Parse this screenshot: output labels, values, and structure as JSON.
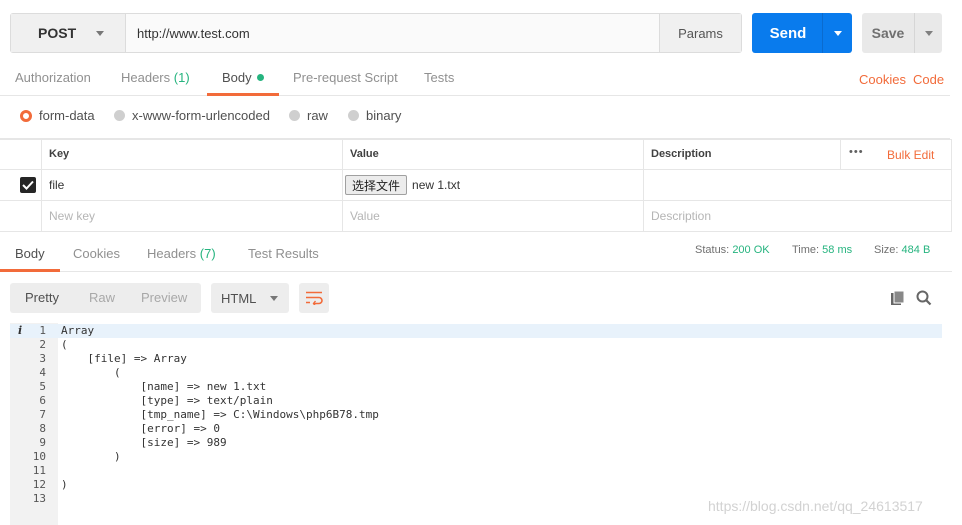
{
  "request": {
    "method": "POST",
    "url": "http://www.test.com",
    "params_label": "Params",
    "send_label": "Send",
    "save_label": "Save"
  },
  "request_tabs": [
    {
      "label": "Authorization"
    },
    {
      "label": "Headers",
      "count": "(1)"
    },
    {
      "label": "Body",
      "active": true
    },
    {
      "label": "Pre-request Script"
    },
    {
      "label": "Tests"
    }
  ],
  "links": {
    "cookies": "Cookies",
    "code": "Code"
  },
  "body_types": [
    "form-data",
    "x-www-form-urlencoded",
    "raw",
    "binary"
  ],
  "body_type_selected": "form-data",
  "kv_table": {
    "headers": {
      "key": "Key",
      "value": "Value",
      "description": "Description"
    },
    "more_label": "•••",
    "bulk_edit": "Bulk Edit",
    "rows": [
      {
        "checked": true,
        "key": "file",
        "file_button": "选择文件",
        "file_name": "new 1.txt",
        "description": ""
      }
    ],
    "new_row": {
      "key_placeholder": "New key",
      "value_placeholder": "Value",
      "description_placeholder": "Description"
    }
  },
  "response_tabs": [
    {
      "label": "Body",
      "active": true
    },
    {
      "label": "Cookies"
    },
    {
      "label": "Headers",
      "count": "(7)"
    },
    {
      "label": "Test Results"
    }
  ],
  "response_status": {
    "status_label": "Status:",
    "status_value": "200 OK",
    "time_label": "Time:",
    "time_value": "58 ms",
    "size_label": "Size:",
    "size_value": "484 B"
  },
  "view_modes": [
    "Pretty",
    "Raw",
    "Preview"
  ],
  "format": "HTML",
  "code_lines": [
    "Array",
    "(",
    "    [file] => Array",
    "        (",
    "            [name] => new 1.txt",
    "            [type] => text/plain",
    "            [tmp_name] => C:\\Windows\\php6B78.tmp",
    "            [error] => 0",
    "            [size] => 989",
    "        )",
    "",
    ")",
    ""
  ],
  "watermark": "https://blog.csdn.net/qq_24613517",
  "colors": {
    "accent": "#f26b3a",
    "send": "#097bed",
    "success": "#26b47f"
  }
}
